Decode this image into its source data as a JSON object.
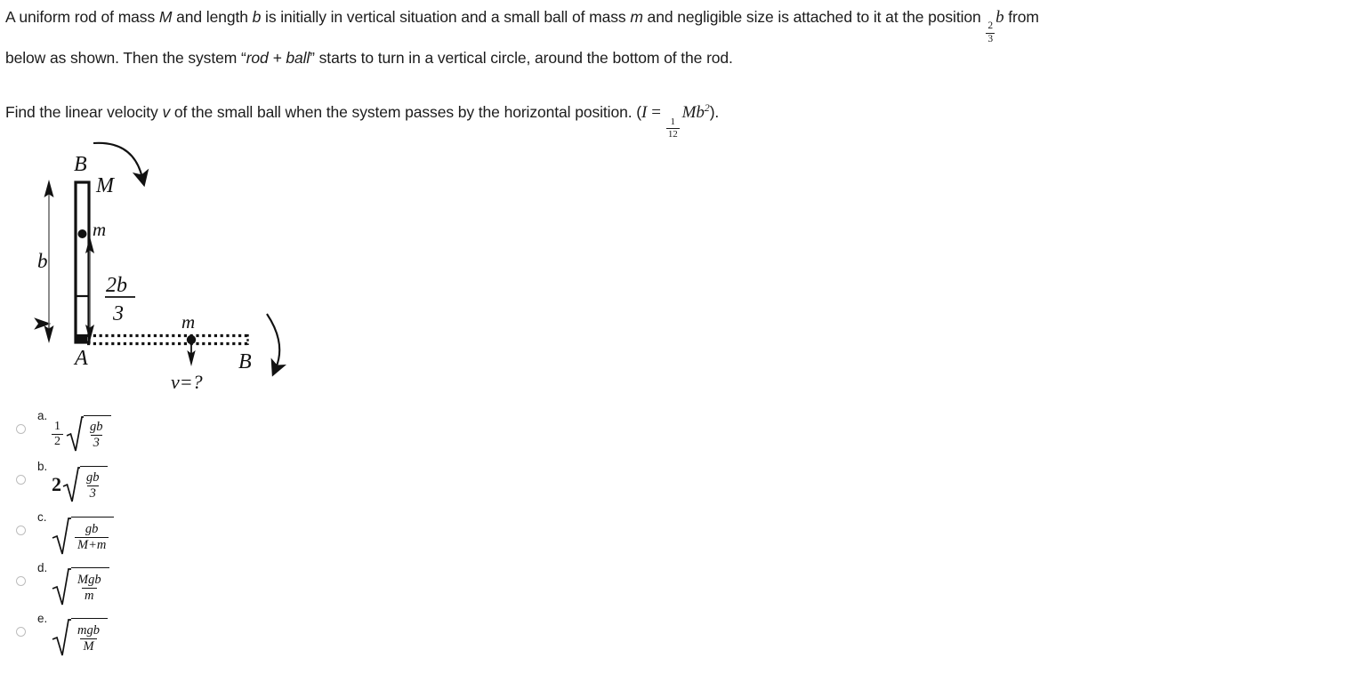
{
  "question": {
    "line1_a": "A uniform rod of mass ",
    "line1_M": "M",
    "line1_b": " and length ",
    "line1_blen": "b",
    "line1_c": " is initially in vertical situation and a small ball of mass ",
    "line1_m": "m",
    "line1_d": " and negligible size is attached to it at the position ",
    "pos_frac_num": "2",
    "pos_frac_den": "3",
    "pos_frac_var": "b",
    "line1_e": " from",
    "line2_a": "below as shown. Then the system “",
    "line2_rodball": "rod + ball",
    "line2_b": "” starts to turn in a vertical circle, around the bottom of the rod.",
    "line3_a": "Find the linear velocity ",
    "line3_v": "v",
    "line3_b": " of the small ball when the system passes by the horizontal position. (",
    "inertia_I": "I",
    "inertia_eq": "=",
    "inertia_num": "1",
    "inertia_den": "12",
    "inertia_M": "M",
    "inertia_b": "b",
    "inertia_exp": "2",
    "line3_c": ")."
  },
  "figure": {
    "label_b": "b",
    "label_B_top": "B",
    "label_M": "M",
    "label_m_rod": "m",
    "label_frac_num": "2b",
    "label_frac_den": "3",
    "label_A": "A",
    "label_m_horizontal": "m",
    "label_B_right": "B",
    "label_v": "v=?",
    "stroke_color": "#111111",
    "rod_fill": "#ffffff"
  },
  "options": [
    {
      "letter": "a.",
      "coefficient_type": "fraction",
      "coef_num": "1",
      "coef_den": "2",
      "radicand_num": "gb",
      "radicand_den": "3",
      "expression": "(1/2) sqrt(gb/3)"
    },
    {
      "letter": "b.",
      "coefficient_type": "number",
      "coef_num": "2",
      "coef_den": "",
      "radicand_num": "gb",
      "radicand_den": "3",
      "expression": "2 sqrt(gb/3)"
    },
    {
      "letter": "c.",
      "coefficient_type": "none",
      "coef_num": "",
      "coef_den": "",
      "radicand_num": "gb",
      "radicand_den": "M+m",
      "expression": "sqrt(gb/(M+m))"
    },
    {
      "letter": "d.",
      "coefficient_type": "none",
      "coef_num": "",
      "coef_den": "",
      "radicand_num": "Mgb",
      "radicand_den": "m",
      "expression": "sqrt(Mgb/m)"
    },
    {
      "letter": "e.",
      "coefficient_type": "none",
      "coef_num": "",
      "coef_den": "",
      "radicand_num": "mgb",
      "radicand_den": "M",
      "expression": "sqrt(mgb/M)"
    }
  ]
}
